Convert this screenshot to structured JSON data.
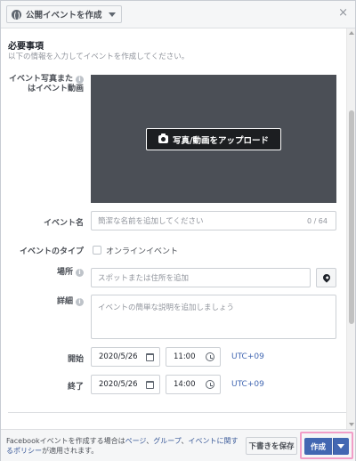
{
  "header": {
    "privacy_label": "公開イベントを作成",
    "close_glyph": "×"
  },
  "section": {
    "title": "必要事項",
    "subtitle": "以下の情報を入力してイベントを作成してください。"
  },
  "photo": {
    "label_line1": "イベント写真また",
    "label_line2": "はイベント動画",
    "upload_label": "写真/動画をアップロード"
  },
  "event_name": {
    "label": "イベント名",
    "placeholder": "簡潔な名前を追加してください",
    "counter": "0 / 64"
  },
  "event_type": {
    "label": "イベントのタイプ",
    "option_label": "オンラインイベント"
  },
  "location": {
    "label": "場所",
    "placeholder": "スポットまたは住所を追加"
  },
  "details": {
    "label": "詳細",
    "placeholder": "イベントの簡単な説明を追加しましょう"
  },
  "start": {
    "label": "開始",
    "date": "2020/5/26",
    "time": "11:00",
    "timezone": "UTC+09"
  },
  "end": {
    "label": "終了",
    "date": "2020/5/26",
    "time": "14:00",
    "timezone": "UTC+09"
  },
  "footer": {
    "text_prefix": "Facebookイベントを作成する場合は",
    "link_page": "ページ",
    "sep1": "、",
    "link_group": "グループ",
    "sep2": "、",
    "link_event": "イベントに関するポリシー",
    "text_suffix": "が適用されます。",
    "draft_label": "下書きを保存",
    "create_label": "作成"
  },
  "colors": {
    "accent": "#4267b2",
    "link": "#385898",
    "highlight_border": "#f29ec8"
  }
}
